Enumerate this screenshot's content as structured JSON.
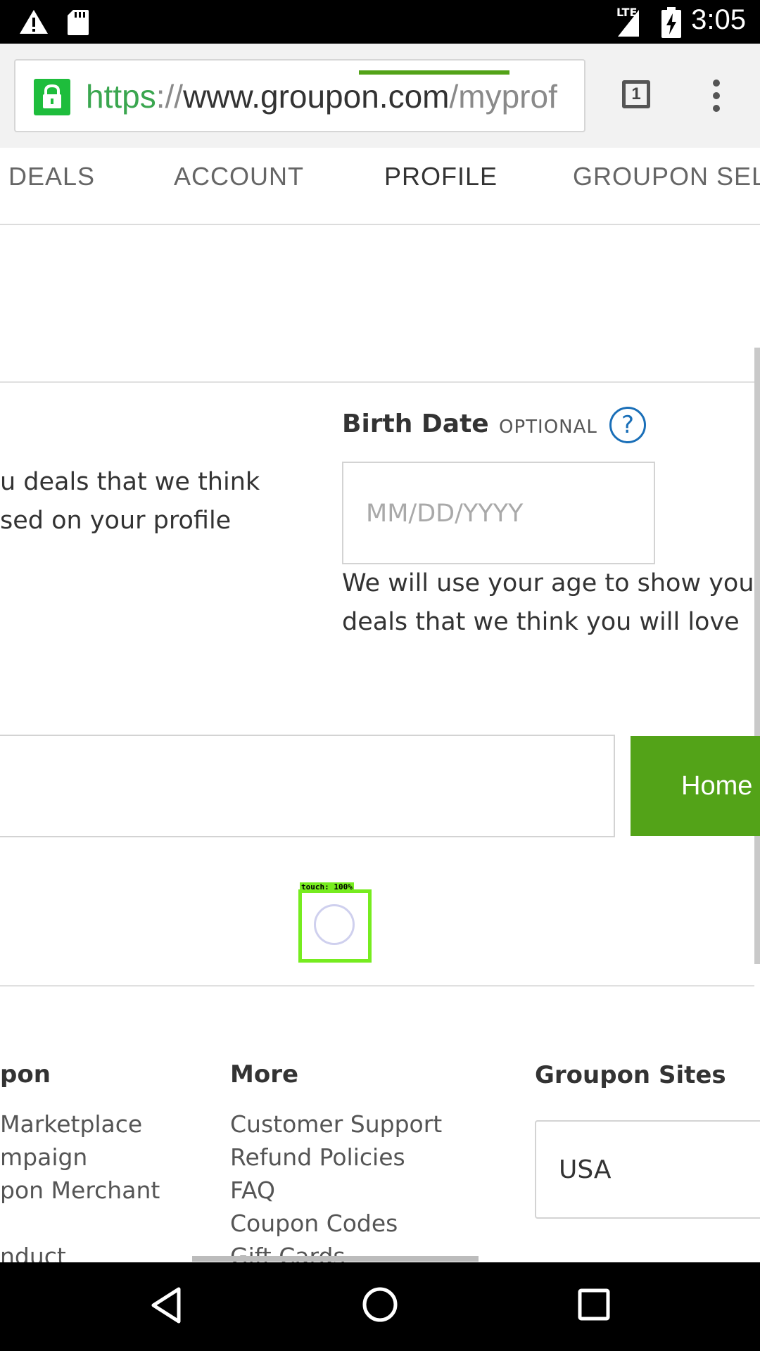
{
  "status_bar": {
    "time": "3:05",
    "network": "LTE",
    "icons": [
      "warning-icon",
      "sd-card-icon",
      "signal-icon",
      "battery-charging-icon"
    ]
  },
  "browser": {
    "url_scheme": "https",
    "url_separator": "://",
    "url_host": "www.groupon.com",
    "url_path": "/myprof",
    "tab_count": "1",
    "icons": [
      "lock-icon",
      "tabs-icon",
      "overflow-menu-icon"
    ],
    "colors": {
      "secure": "#1ebd3c"
    }
  },
  "tabs": [
    {
      "label": "DEALS"
    },
    {
      "label": "ACCOUNT"
    },
    {
      "label": "PROFILE",
      "active": true
    },
    {
      "label": "GROUPON SELE"
    }
  ],
  "profile": {
    "left_text_lines": [
      "u deals that we think",
      "sed on your profile"
    ],
    "birth_date": {
      "label": "Birth Date",
      "optional_label": "OPTIONAL",
      "help_glyph": "?",
      "placeholder": "MM/DD/YYYY",
      "help_lines": [
        "We will use your age to show you",
        "deals that we think you will love"
      ]
    },
    "address": {
      "value": "",
      "button_label": "Home"
    }
  },
  "touch_overlay": {
    "label": "touch: 100%"
  },
  "footer": {
    "col1": {
      "title": "pon",
      "links": [
        "Marketplace",
        "mpaign",
        "pon Merchant",
        "nduct"
      ]
    },
    "col2": {
      "title": "More",
      "links": [
        "Customer Support",
        "Refund Policies",
        "FAQ",
        "Coupon Codes",
        "Gift Cards"
      ]
    },
    "col3": {
      "title": "Groupon Sites",
      "selected": "USA"
    }
  },
  "theme": {
    "accent": "#53a318",
    "link_blue": "#1a6fb8"
  }
}
